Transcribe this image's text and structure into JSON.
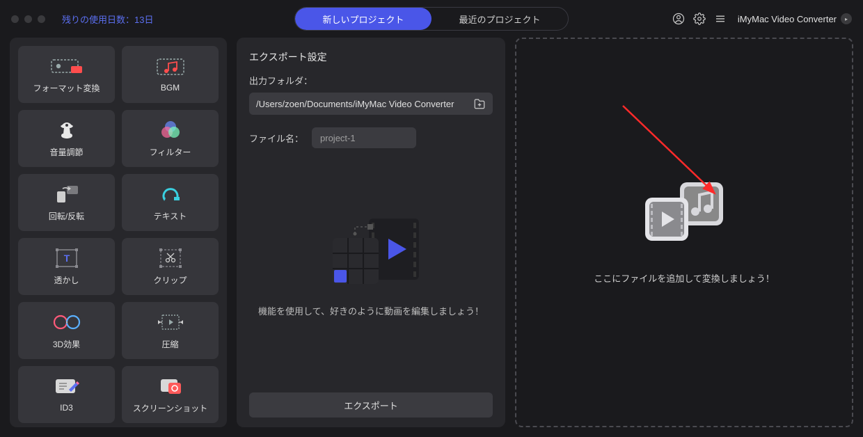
{
  "topbar": {
    "trial_text": "残りの使用日数：13日",
    "tab_new": "新しいプロジェクト",
    "tab_recent": "最近のプロジェクト",
    "app_name": "iMyMac Video Converter"
  },
  "sidebar": {
    "tools": [
      {
        "id": "format-convert",
        "label": "フォーマット変換"
      },
      {
        "id": "bgm",
        "label": "BGM"
      },
      {
        "id": "volume",
        "label": "音量調節"
      },
      {
        "id": "filter",
        "label": "フィルター"
      },
      {
        "id": "rotate-flip",
        "label": "回転/反転"
      },
      {
        "id": "text",
        "label": "テキスト"
      },
      {
        "id": "watermark",
        "label": "透かし"
      },
      {
        "id": "clip",
        "label": "クリップ"
      },
      {
        "id": "3d",
        "label": "3D効果"
      },
      {
        "id": "compress",
        "label": "圧縮"
      },
      {
        "id": "id3",
        "label": "ID3"
      },
      {
        "id": "screenshot",
        "label": "スクリーンショット"
      }
    ]
  },
  "center": {
    "title": "エクスポート設定",
    "folder_label": "出力フォルダ：",
    "folder_path": "/Users/zoen/Documents/iMyMac Video Converter",
    "filename_label": "ファイル名：",
    "filename_value": "project-1",
    "hint": "機能を使用して、好きのように動画を編集しましょう！",
    "export_label": "エクスポート"
  },
  "dropzone": {
    "hint": "ここにファイルを追加して変換しましょう！"
  },
  "colors": {
    "accent": "#4a56e8",
    "arrow": "#ff2a2a"
  }
}
